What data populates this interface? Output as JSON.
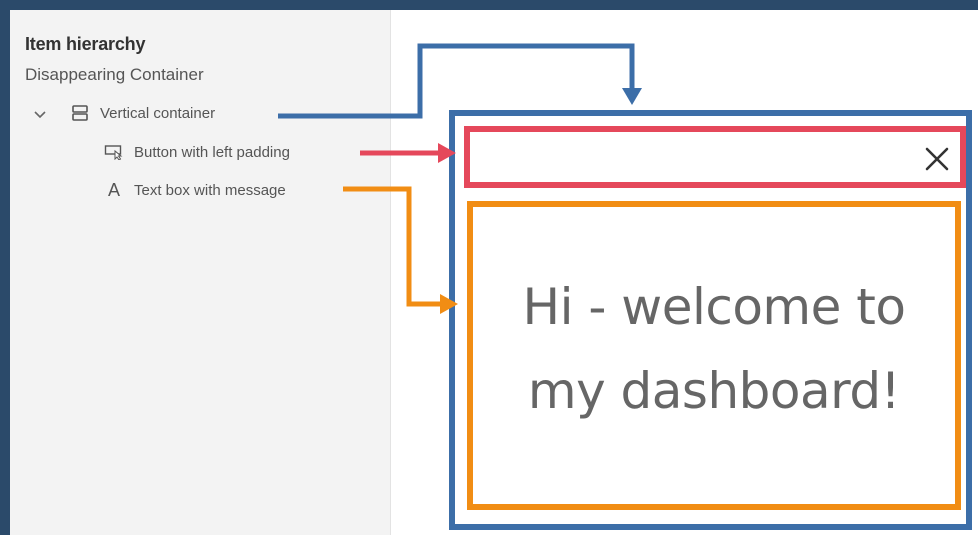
{
  "sidebar": {
    "title": "Item hierarchy",
    "subtitle": "Disappearing Container",
    "items": [
      {
        "label": "Vertical container",
        "icon": "vertical-container-icon",
        "expanded": true
      },
      {
        "label": "Button with left padding",
        "icon": "button-icon"
      },
      {
        "label": "Text box with message",
        "icon": "text-icon",
        "glyph": "A"
      }
    ]
  },
  "canvas": {
    "message": "Hi - welcome to my dashboard!",
    "close_glyph": "✕"
  },
  "colors": {
    "background": "#2b4a6a",
    "container_blue": "#3c6ea8",
    "button_red": "#e5485b",
    "text_orange": "#f18d14"
  }
}
